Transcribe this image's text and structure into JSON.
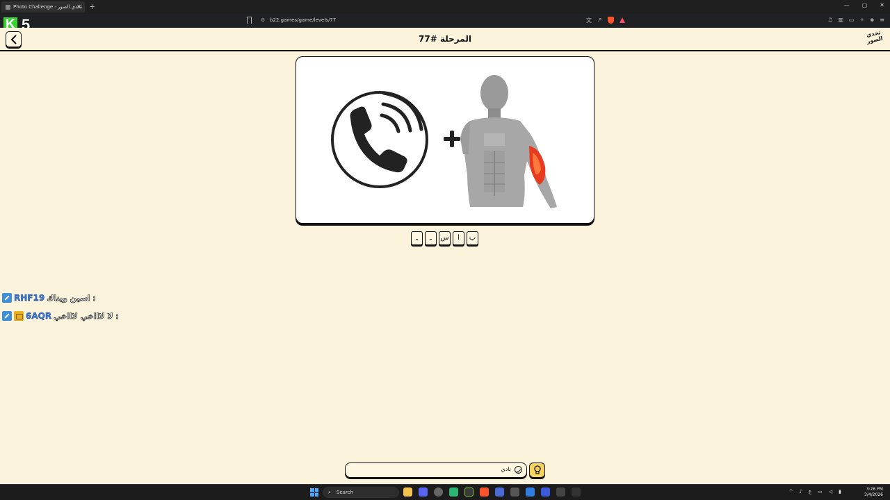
{
  "browser": {
    "tab_title": "Photo Challenge - تحدي الصور",
    "url": "b22.games/game/levels/77",
    "new_tab_label": "+",
    "window_controls": [
      "—",
      "▢",
      "✕"
    ]
  },
  "overlay": {
    "streamer_badge": "5"
  },
  "header": {
    "level_title": "المرحلة #77",
    "logo_text": "تحدي الصور"
  },
  "puzzle": {
    "operator": "+",
    "images": [
      "phone-call-icon",
      "arm-muscle-anatomy"
    ]
  },
  "answer_slots": [
    {
      "letter": "ب"
    },
    {
      "letter": "ا"
    },
    {
      "letter": "س"
    },
    {
      "letter": "ـ"
    },
    {
      "letter": "ـ"
    }
  ],
  "chat": [
    {
      "user": "RHF19",
      "message": "اسين ويناك :",
      "badges": [
        "mod"
      ]
    },
    {
      "user": "6AQR",
      "message": "لا لاااخي لاااخي :",
      "badges": [
        "mod",
        "sub"
      ]
    }
  ],
  "answer_input": {
    "value": "نادي"
  },
  "taskbar": {
    "search_label": "Search",
    "time": "3:26 PM",
    "date": "3/4/2026",
    "lang": "ع"
  },
  "colors": {
    "page_bg": "#fbf3dc",
    "hint_bg": "#f6d260",
    "chat_user": "#3a7ad8"
  }
}
